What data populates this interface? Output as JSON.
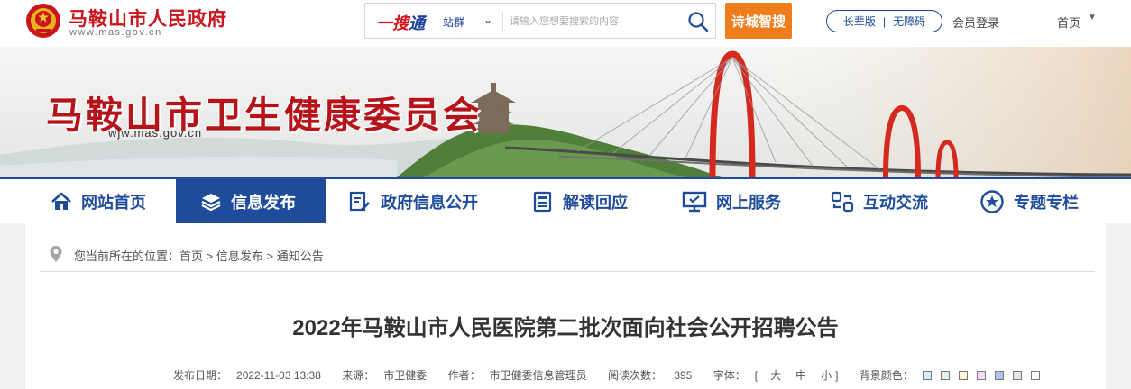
{
  "header": {
    "site_title": "马鞍山市人民政府",
    "site_domain": "www.mas.gov.cn",
    "search": {
      "logo_prefix": "一搜",
      "logo_suffix": "通",
      "scope": "站群",
      "placeholder": "请输入您想要搜索的内容"
    },
    "smart_button": "诗城智搜",
    "elder_mode": "长辈版",
    "accessibility": "无障碍",
    "login": "会员登录",
    "home": "首页"
  },
  "banner": {
    "title": "马鞍山市卫生健康委员会",
    "domain": "wjw.mas.gov.cn"
  },
  "nav": {
    "items": [
      {
        "label": "网站首页",
        "icon": "home-icon"
      },
      {
        "label": "信息发布",
        "icon": "layers-icon"
      },
      {
        "label": "政府信息公开",
        "icon": "document-edit-icon"
      },
      {
        "label": "解读回应",
        "icon": "notebook-icon"
      },
      {
        "label": "网上服务",
        "icon": "monitor-icon"
      },
      {
        "label": "互动交流",
        "icon": "exchange-icon"
      },
      {
        "label": "专题专栏",
        "icon": "star-icon"
      }
    ],
    "active_index": 1,
    "accent_color": "#1f4b9b"
  },
  "breadcrumb": {
    "prefix": "您当前所在的位置：",
    "items": [
      "首页",
      "信息发布",
      "通知公告"
    ],
    "separator": ">"
  },
  "article": {
    "title": "2022年马鞍山市人民医院第二批次面向社会公开招聘公告",
    "meta": {
      "date_label": "发布日期：",
      "date": "2022-11-03 13:38",
      "source_label": "来源：",
      "source": "市卫健委",
      "author_label": "作者：",
      "author": "市卫健委信息管理员",
      "views_label": "阅读次数：",
      "views": "395",
      "font_label": "字体：",
      "font_open": "[",
      "font_sizes": [
        "大",
        "中",
        "小"
      ],
      "font_close": "]",
      "bg_label": "背景颜色：",
      "bg_colors": [
        "#dbeef8",
        "#e3f3ee",
        "#fbf7d9",
        "#f9ddf0",
        "#a9c7ea",
        "#e6e6e6",
        "#ffffff"
      ]
    }
  }
}
